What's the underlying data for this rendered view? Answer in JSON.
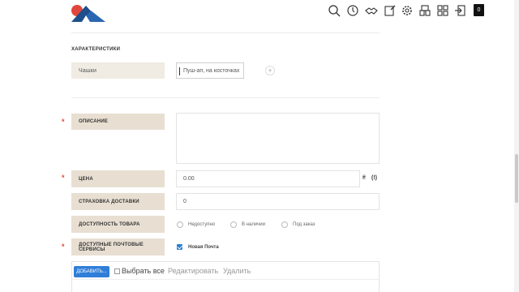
{
  "header": {
    "icons": [
      "search-icon",
      "clock-icon",
      "handshake-icon",
      "edit-icon",
      "gear-icon",
      "layers-icon",
      "grid-icon",
      "logout-icon"
    ],
    "badge": "0"
  },
  "characteristics": {
    "title": "ХАРАКТЕРИСТИКИ",
    "name": "Чашки",
    "value": "Пуш-ап, на косточках",
    "add": "+"
  },
  "form": {
    "description_label": "ОПИСАНИЕ",
    "price_label": "ЦЕНА",
    "price_value": "0.00",
    "currency": "₴",
    "price_info": "(!)",
    "insurance_label": "СТРАХОВКА ДОСТАВКИ",
    "insurance_value": "0",
    "availability_label": "ДОСТУПНОСТЬ ТОВАРА",
    "availability_options": [
      "Недоступно",
      "В наличии",
      "Под заказ"
    ],
    "postal_label": "ДОСТУПНЫЕ ПОЧТОВЫЕ СЕРВИСЫ",
    "postal_service": "Новая Почта",
    "required_mark": "*"
  },
  "photos": {
    "add_label": "ДОБАВИТЬ...",
    "select_all_label": "Выбрать все",
    "edit_label": "Редактировать",
    "delete_label": "Удалить"
  },
  "colors": {
    "label_bg": "#e8dfd2",
    "accent_blue": "#2f7ed8",
    "required_red": "#e0463b"
  }
}
